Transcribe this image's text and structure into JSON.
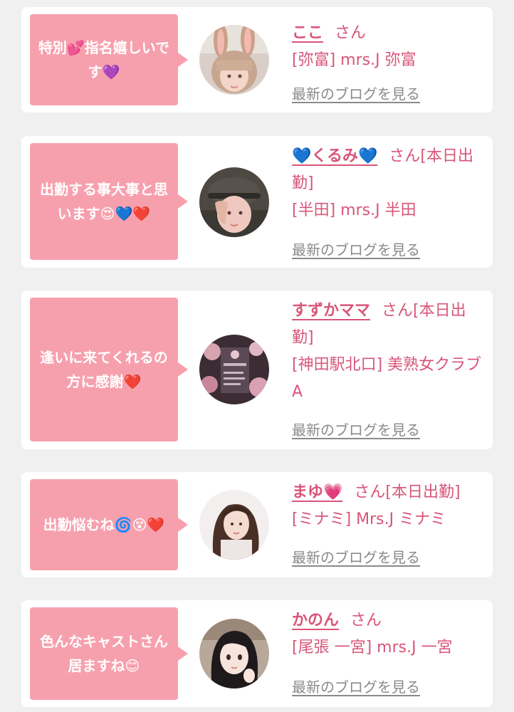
{
  "blog_link_label": "最新のブログを見る",
  "colors": {
    "background": "#f0f0f0",
    "card": "#ffffff",
    "bubble": "#f7a0ad",
    "accent": "#d9557a",
    "link_gray": "#8a8a8a"
  },
  "cards": [
    {
      "comment": "特別💕指名嬉しいです💜",
      "name": "ここ",
      "san": "さん",
      "shop_line1": "[弥富] mrs.J 弥富",
      "shop_line2": "",
      "avatar_icon": "avatar-bunny-ears-photo"
    },
    {
      "comment": "出勤する事大事と思います😍💙❤️",
      "name": "💙くるみ💙",
      "san": "さん[本日出勤]",
      "shop_line1": "[半田] mrs.J 半田",
      "shop_line2": "",
      "avatar_icon": "avatar-cap-photo"
    },
    {
      "comment": "逢いに来てくれるの方に感謝❤️",
      "name": "すずかママ",
      "san": "さん[本日出勤]",
      "shop_line1": "[神田駅北口] 美熟女クラブA",
      "shop_line2": "",
      "avatar_icon": "avatar-floral-card-photo"
    },
    {
      "comment": "出勤悩むね🌀😵❤️",
      "name": "まゆ💗",
      "san": "さん[本日出勤]",
      "shop_line1": "[ミナミ] Mrs.J ミナミ",
      "shop_line2": "",
      "avatar_icon": "avatar-long-hair-photo"
    },
    {
      "comment": "色んなキャストさん居ますね😊",
      "name": "かのん",
      "san": "さん",
      "shop_line1": "[尾張 一宮] mrs.J 一宮",
      "shop_line2": "",
      "avatar_icon": "avatar-anime-illustration"
    }
  ]
}
